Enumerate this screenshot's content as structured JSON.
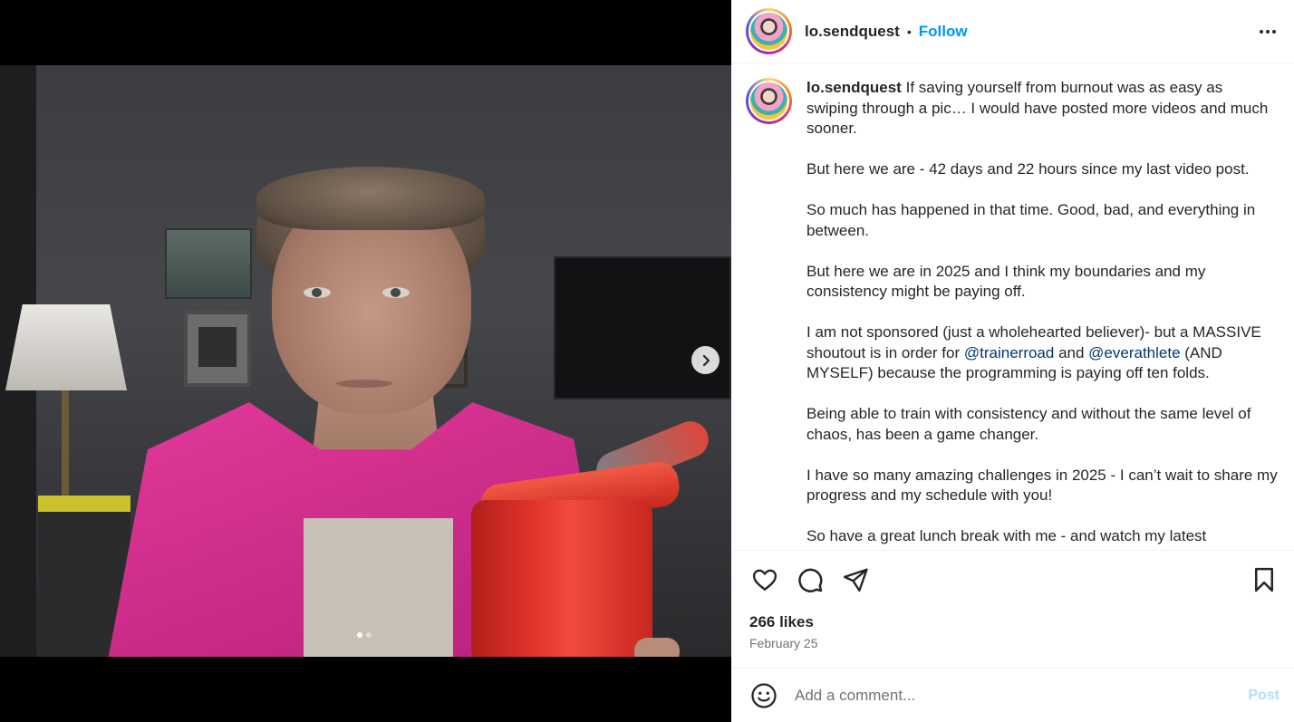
{
  "post": {
    "username": "lo.sendquest",
    "separator": "•",
    "follow_label": "Follow",
    "more_icon": "more-horizontal-icon"
  },
  "caption": {
    "username": "lo.sendquest",
    "p1": "If saving yourself from burnout was as easy as swiping through a pic… I would have posted more videos and much sooner.",
    "p2": "But here we are - 42 days and 22 hours since my last video post.",
    "p3": "So much has happened in that time. Good, bad, and everything in between.",
    "p4": "But here we are in 2025 and I think my boundaries and my consistency might be paying off.",
    "p5_a": "I am not sponsored (just a wholehearted believer)- but a MASSIVE shoutout is in order for ",
    "p5_mention1": "@trainerroad",
    "p5_b": " and ",
    "p5_mention2": "@everathlete",
    "p5_c": " (AND MYSELF) because the programming is paying off ten folds.",
    "p6": "Being able to train with consistency and without the same level of chaos, has been a game changer.",
    "p7": "I have so many amazing challenges in 2025 - I can’t wait to share my progress and my schedule with you!",
    "p8": "So have a great lunch break with me - and watch my latest"
  },
  "engagement": {
    "likes": "266 likes",
    "date": "February 25"
  },
  "comment": {
    "placeholder": "Add a comment...",
    "post_label": "Post"
  },
  "carousel": {
    "total_slides": 2,
    "current_slide": 1
  },
  "colors": {
    "follow_blue": "#0095f6",
    "mention_blue": "#00376b",
    "post_disabled": "#b2dffc",
    "muted_gray": "#737373"
  }
}
